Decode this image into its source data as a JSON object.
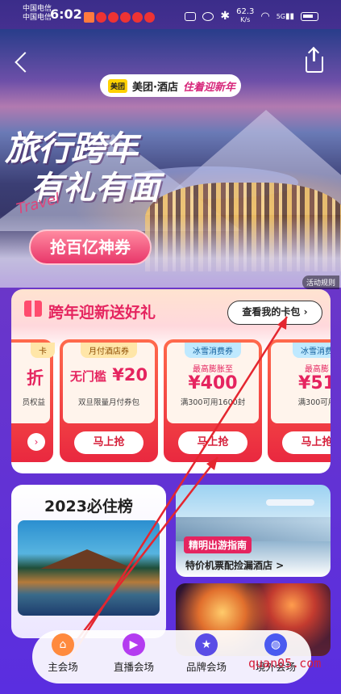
{
  "status_bar": {
    "carrier_1": "中国电信",
    "carrier_2": "中国电信",
    "time": "6:02",
    "speed": "62.3",
    "speed_unit": "K/s",
    "signal": "5G"
  },
  "header": {
    "brand": "美团·酒店",
    "brand_logo": "美团",
    "slogan": "住着迎新年"
  },
  "hero": {
    "title_line1": "旅行跨年",
    "title_line2": "有礼有面",
    "script_text": "Travel",
    "cta": "抢百亿神券",
    "rules_label": "活动规则"
  },
  "gift_section": {
    "title": "跨年迎新送好礼",
    "wallet_button": "查看我的卡包"
  },
  "coupons": [
    {
      "tag": "卡",
      "big": "折",
      "sub": "员权益"
    },
    {
      "tag": "月付酒店券",
      "big_prefix": "无门槛",
      "big_value": "¥20",
      "sub": "双旦限量月付券包",
      "button": "马上抢"
    },
    {
      "tag": "冰雪消费券",
      "mid": "最高膨胀至",
      "amount": "¥400",
      "sub": "满300可用1600封",
      "button": "马上抢"
    },
    {
      "tag": "冰雪消费",
      "mid": "最高膨",
      "amount": "¥51",
      "sub": "满300可用",
      "button": "马上抢"
    }
  ],
  "promos": {
    "ranking_title": "2023必住榜",
    "flight_tag": "精明出游指南",
    "flight_text": "特价机票配捡漏酒店 >"
  },
  "bottom_nav": [
    {
      "label": "主会场",
      "icon": "home-icon",
      "color": "#ff8a3d"
    },
    {
      "label": "直播会场",
      "icon": "tv-icon",
      "color": "#b43cf0"
    },
    {
      "label": "品牌会场",
      "icon": "star-icon",
      "color": "#5a4ce6"
    },
    {
      "label": "境外会场",
      "icon": "globe-icon",
      "color": "#4a5af0"
    }
  ],
  "watermark": "quan05.com"
}
